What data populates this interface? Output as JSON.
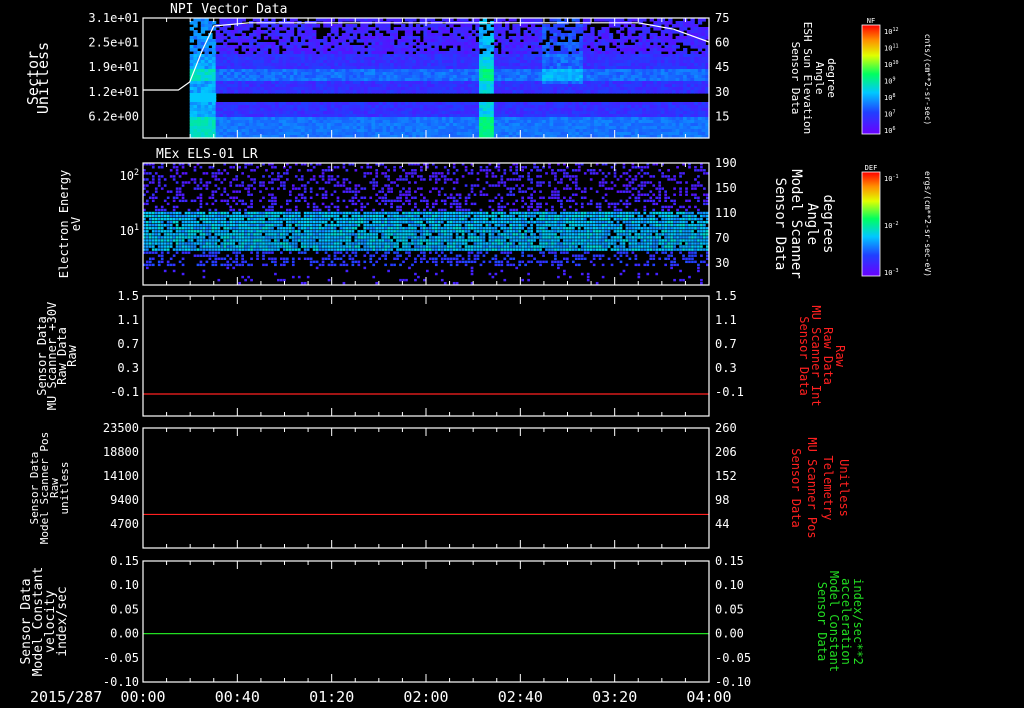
{
  "date": "2015/287",
  "time_ticks": [
    "00:00",
    "00:40",
    "01:20",
    "02:00",
    "02:40",
    "03:20",
    "04:00"
  ],
  "colors": {
    "white": "#ffffff",
    "red": "#ff2020",
    "green": "#22dd22",
    "frame": "#ffffff"
  },
  "colorbars": [
    {
      "label": "NF",
      "unit": "cnts/(cm**2-sr-sec)",
      "ticks": [
        "10^12",
        "10^11",
        "10^10",
        "10^9",
        "10^8",
        "10^7",
        "10^6"
      ]
    },
    {
      "label": "DEF",
      "unit": "ergs/(cm**2-sr-sec-eV)",
      "ticks": [
        "10^-1",
        "10^-2",
        "10^-3"
      ]
    }
  ],
  "panels": [
    {
      "id": "npi",
      "title": "NPI Vector Data",
      "left_label": [
        "Sector",
        "Unitless"
      ],
      "left_ticks": [
        "3.1e+01",
        "2.5e+01",
        "1.9e+01",
        "1.2e+01",
        "6.2e+00"
      ],
      "right_label": [
        "Sensor Data",
        "ESH Sun Elevation",
        "Angle",
        "degree"
      ],
      "right_ticks": [
        "75",
        "60",
        "45",
        "30",
        "15"
      ]
    },
    {
      "id": "els",
      "title": "MEx ELS-01 LR",
      "left_label": [
        "Electron Energy",
        "eV"
      ],
      "left_ticks": [
        "10^2",
        "10^1"
      ],
      "right_label": [
        "Sensor Data",
        "Model Scanner",
        "Angle",
        "degrees"
      ],
      "right_ticks": [
        "190",
        "150",
        "110",
        "70",
        "30"
      ]
    },
    {
      "id": "p3",
      "title": "",
      "left_label": [
        "Sensor Data",
        "MU Scanner +30V",
        "Raw Data",
        "Raw"
      ],
      "left_ticks": [
        "1.5",
        "1.1",
        "0.7",
        "0.3",
        "-0.1"
      ],
      "right_label": [
        "Sensor Data",
        "MU Scanner Int",
        "Raw Data",
        "Raw"
      ],
      "right_ticks": [
        "1.5",
        "1.1",
        "0.7",
        "0.3",
        "-0.1"
      ]
    },
    {
      "id": "p4",
      "title": "",
      "left_label": [
        "Sensor Data",
        "Model Scanner Pos",
        "Raw",
        "unitless"
      ],
      "left_ticks": [
        "23500",
        "18800",
        "14100",
        "9400",
        "4700"
      ],
      "right_label": [
        "Sensor Data",
        "MU Scanner Pos",
        "Telemetry",
        "Unitless"
      ],
      "right_ticks": [
        "260",
        "206",
        "152",
        "98",
        "44"
      ]
    },
    {
      "id": "p5",
      "title": "",
      "left_label": [
        "Sensor Data",
        "Model Constant",
        "velocity",
        "index/sec"
      ],
      "left_ticks": [
        "0.15",
        "0.10",
        "0.05",
        "0.00",
        "-0.05",
        "-0.10"
      ],
      "right_label": [
        "Sensor Data",
        "Model Constant",
        "acceleration",
        "index/sec**2"
      ],
      "right_ticks": [
        "0.15",
        "0.10",
        "0.05",
        "0.00",
        "-0.05",
        "-0.10"
      ]
    }
  ],
  "chart_data": [
    {
      "type": "heatmap",
      "title": "NPI Vector Data",
      "x_range": [
        "00:00",
        "04:00"
      ],
      "ylabel": "Sector Unitless",
      "ylim": [
        0,
        31
      ],
      "overlay": {
        "name": "ESH Sun Elevation Angle",
        "unit": "degree",
        "y2lim": [
          0,
          75
        ],
        "x_hours": [
          0,
          0.25,
          0.33,
          0.42,
          0.5,
          0.75,
          3.5,
          3.75,
          4.0
        ],
        "values": [
          30,
          30,
          35,
          55,
          70,
          72,
          72,
          68,
          60
        ]
      }
    },
    {
      "type": "heatmap",
      "title": "MEx ELS-01 LR",
      "x_range": [
        "00:00",
        "04:00"
      ],
      "ylabel": "Electron Energy eV",
      "yscale": "log",
      "ylim": [
        1,
        200
      ],
      "y2label": "Model Scanner Angle degrees",
      "y2lim": [
        10,
        190
      ]
    },
    {
      "type": "line",
      "x_range": [
        "00:00",
        "04:00"
      ],
      "ylim": [
        -0.3,
        1.5
      ],
      "series": [
        {
          "name": "MU Scanner Int Raw Data",
          "value": 0.0,
          "color": "red"
        }
      ]
    },
    {
      "type": "line",
      "x_range": [
        "00:00",
        "04:00"
      ],
      "ylim": [
        0,
        23500
      ],
      "y2lim": [
        0,
        260
      ],
      "series": [
        {
          "name": "MU Scanner Pos Telemetry",
          "value_right": 90,
          "color": "red"
        }
      ]
    },
    {
      "type": "line",
      "x_range": [
        "00:00",
        "04:00"
      ],
      "ylim": [
        -0.1,
        0.15
      ],
      "series": [
        {
          "name": "Model Constant acceleration",
          "value": 0.0,
          "color": "green"
        }
      ]
    }
  ]
}
